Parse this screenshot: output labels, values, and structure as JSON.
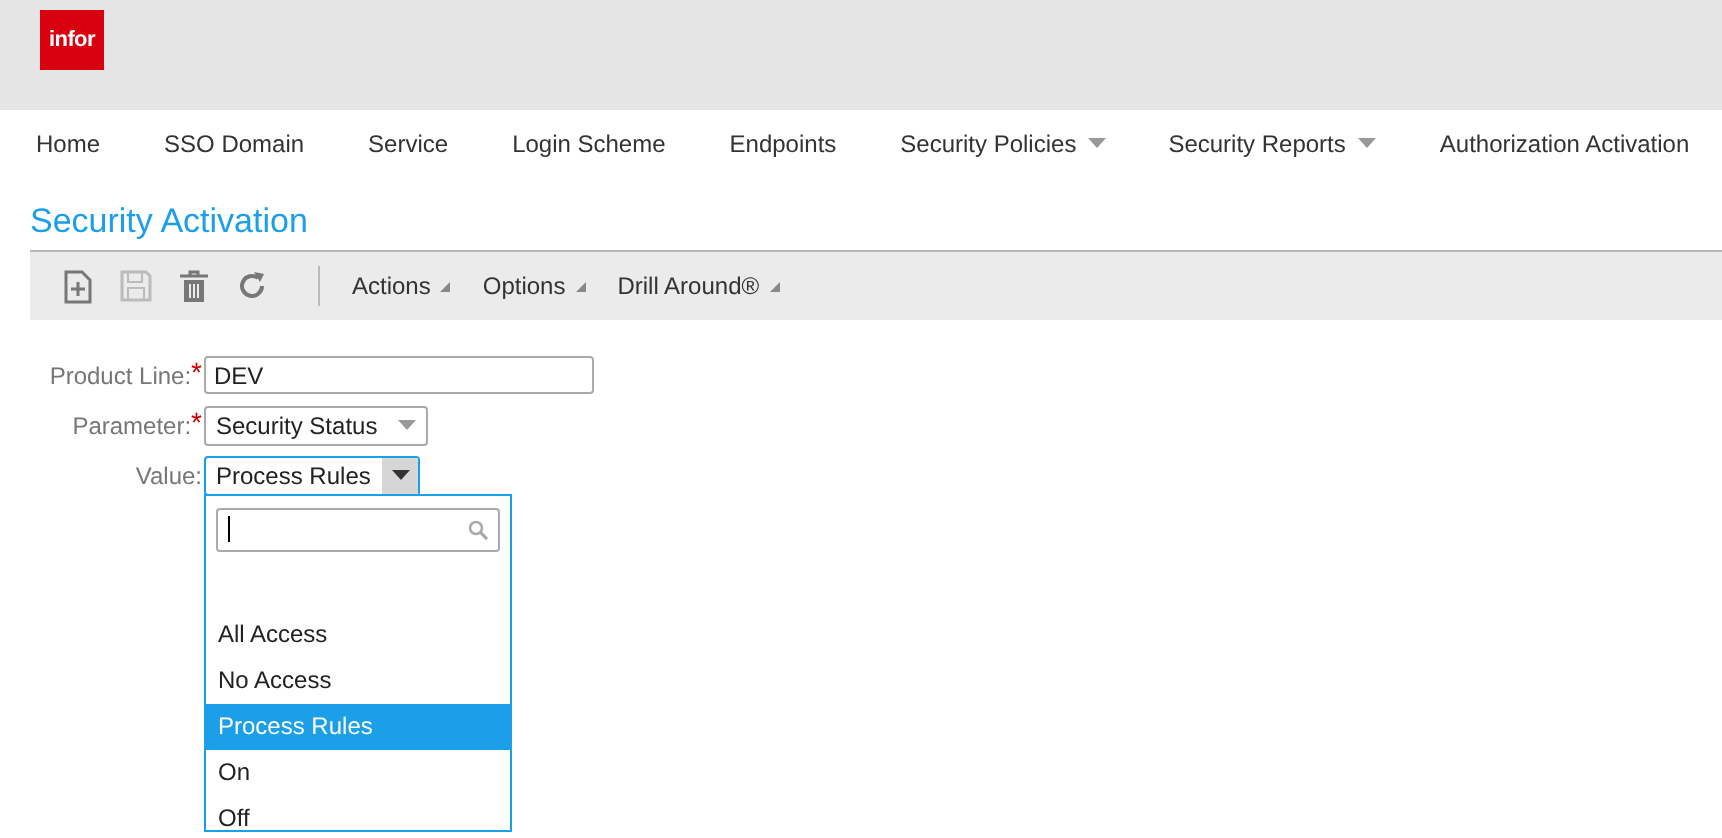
{
  "logo": {
    "text": "infor"
  },
  "nav": [
    {
      "label": "Home",
      "has_menu": false
    },
    {
      "label": "SSO Domain",
      "has_menu": false
    },
    {
      "label": "Service",
      "has_menu": false
    },
    {
      "label": "Login Scheme",
      "has_menu": false
    },
    {
      "label": "Endpoints",
      "has_menu": false
    },
    {
      "label": "Security Policies",
      "has_menu": true
    },
    {
      "label": "Security Reports",
      "has_menu": true
    },
    {
      "label": "Authorization Activation",
      "has_menu": false
    }
  ],
  "page_title": "Security Activation",
  "toolbar": {
    "icons": [
      {
        "kind": "new",
        "disabled": false
      },
      {
        "kind": "save",
        "disabled": true
      },
      {
        "kind": "delete",
        "disabled": false
      },
      {
        "kind": "refresh",
        "disabled": false
      }
    ],
    "menus": [
      "Actions",
      "Options",
      "Drill Around®"
    ]
  },
  "form": [
    {
      "label": "Product Line:",
      "required_mark": "*",
      "kind": "text",
      "value": "DEV"
    },
    {
      "label": "Parameter:",
      "required_mark": "*",
      "kind": "select",
      "value": "Security Status",
      "open": false
    },
    {
      "label": "Value:",
      "kind": "select",
      "value": "Process Rules",
      "open": true
    }
  ],
  "dropdown": {
    "options": [
      {
        "label": "All Access",
        "selected": false
      },
      {
        "label": "No Access",
        "selected": false
      },
      {
        "label": "Process Rules",
        "selected": true
      },
      {
        "label": "On",
        "selected": false
      },
      {
        "label": "Off",
        "selected": false
      }
    ]
  }
}
